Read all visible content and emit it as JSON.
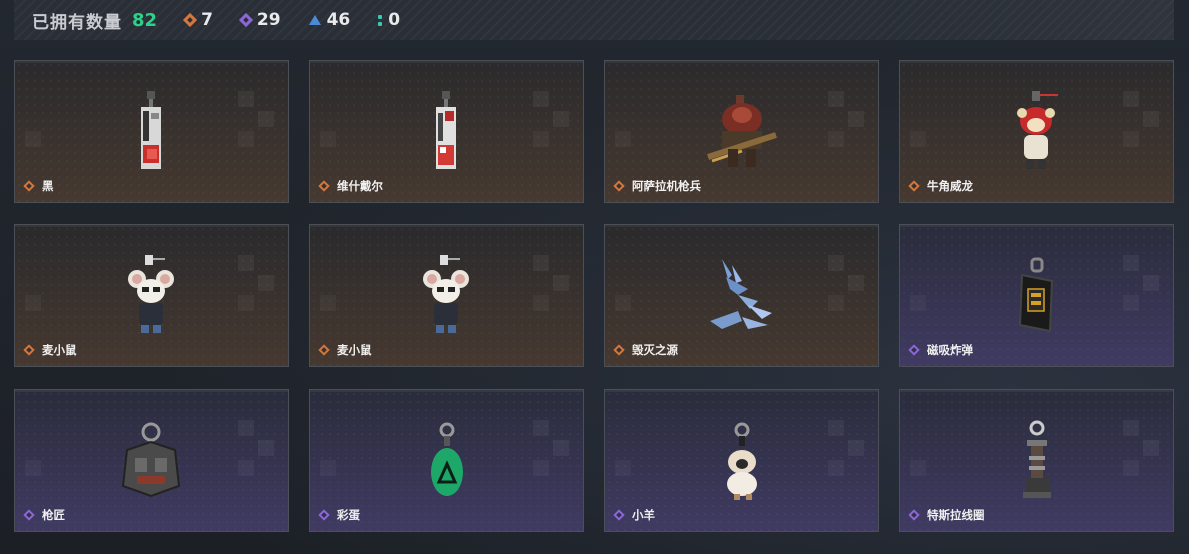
{
  "header": {
    "owned_label": "已拥有数量",
    "owned_count": "82",
    "stats": [
      {
        "icon": "orange-diamond-icon",
        "value": "7"
      },
      {
        "icon": "purple-diamond-icon",
        "value": "29"
      },
      {
        "icon": "blue-triangle-icon",
        "value": "46"
      },
      {
        "icon": "teal-dots-icon",
        "value": "0"
      }
    ]
  },
  "colors": {
    "orange": "#d6773c",
    "purple": "#8d67d8",
    "blue": "#4b8ad8",
    "teal": "#3ac7b5",
    "count": "#2fd08a"
  },
  "items": [
    {
      "name": "黑",
      "rarity": "orange",
      "icon": "card-pendant-icon"
    },
    {
      "name": "维什戴尔",
      "rarity": "orange",
      "icon": "card-pendant-icon"
    },
    {
      "name": "阿萨拉机枪兵",
      "rarity": "orange",
      "icon": "gunner-figure-icon"
    },
    {
      "name": "牛角威龙",
      "rarity": "orange",
      "icon": "dragon-mascot-icon"
    },
    {
      "name": "麦小鼠",
      "rarity": "orange",
      "icon": "mouse-figure-icon"
    },
    {
      "name": "麦小鼠",
      "rarity": "orange",
      "icon": "mouse-figure-icon"
    },
    {
      "name": "毁灭之源",
      "rarity": "orange",
      "icon": "crystal-dragon-icon"
    },
    {
      "name": "磁吸炸弹",
      "rarity": "purple",
      "icon": "bomb-keychain-icon"
    },
    {
      "name": "枪匠",
      "rarity": "purple",
      "icon": "armor-keychain-icon"
    },
    {
      "name": "彩蛋",
      "rarity": "purple",
      "icon": "egg-keychain-icon"
    },
    {
      "name": "小羊",
      "rarity": "purple",
      "icon": "sheep-keychain-icon"
    },
    {
      "name": "特斯拉线圈",
      "rarity": "purple",
      "icon": "tesla-coil-keychain-icon"
    }
  ]
}
